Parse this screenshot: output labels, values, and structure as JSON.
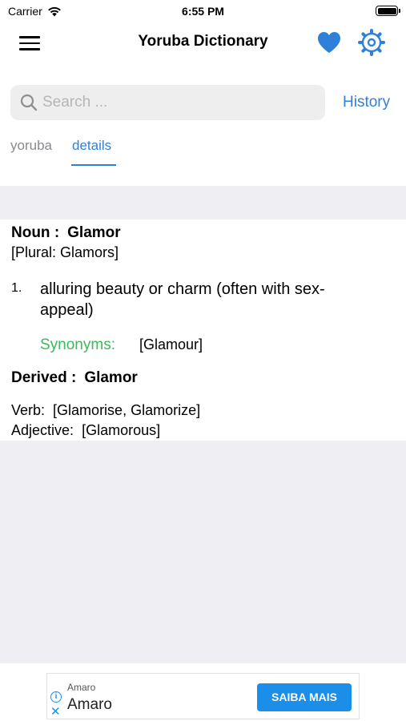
{
  "status_bar": {
    "carrier": "Carrier",
    "time": "6:55 PM"
  },
  "nav": {
    "title": "Yoruba Dictionary"
  },
  "search": {
    "placeholder": "Search ...",
    "value": ""
  },
  "history_label": "History",
  "tabs": [
    {
      "label": "yoruba",
      "active": false
    },
    {
      "label": "details",
      "active": true
    }
  ],
  "entry": {
    "pos_label": "Noun :",
    "word": "Glamor",
    "plural": "[Plural: Glamors]",
    "definitions": [
      {
        "number": "1.",
        "text": "alluring beauty or charm (often with sex-appeal)",
        "synonyms_label": "Synonyms:",
        "synonyms": "[Glamour]"
      }
    ],
    "derived_label": "Derived :",
    "derived_word": "Glamor",
    "verb_label": "Verb:",
    "verb_forms": "[Glamorise, Glamorize]",
    "adjective_label": "Adjective:",
    "adjective_forms": "[Glamorous]"
  },
  "ad": {
    "sponsor_small": "Amaro",
    "sponsor_name": "Amaro",
    "cta": "SAIBA MAIS"
  },
  "colors": {
    "accent": "#2f80d8",
    "synonym_green": "#3cb95a",
    "background_gray": "#efeff3",
    "ad_blue": "#1a8ee8"
  }
}
